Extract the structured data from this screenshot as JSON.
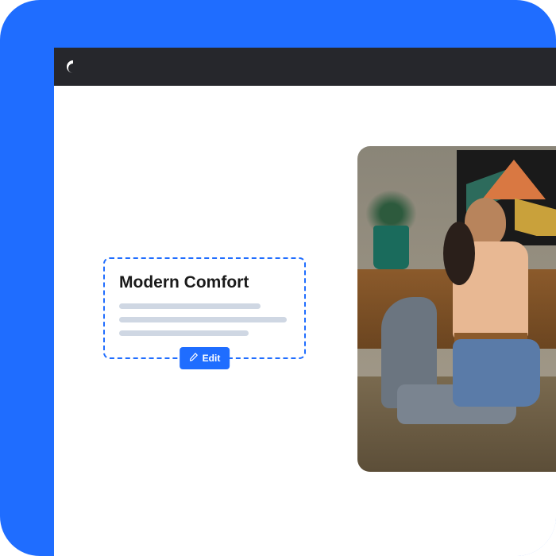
{
  "editable_block": {
    "title": "Modern Comfort"
  },
  "edit_button": {
    "label": "Edit"
  }
}
